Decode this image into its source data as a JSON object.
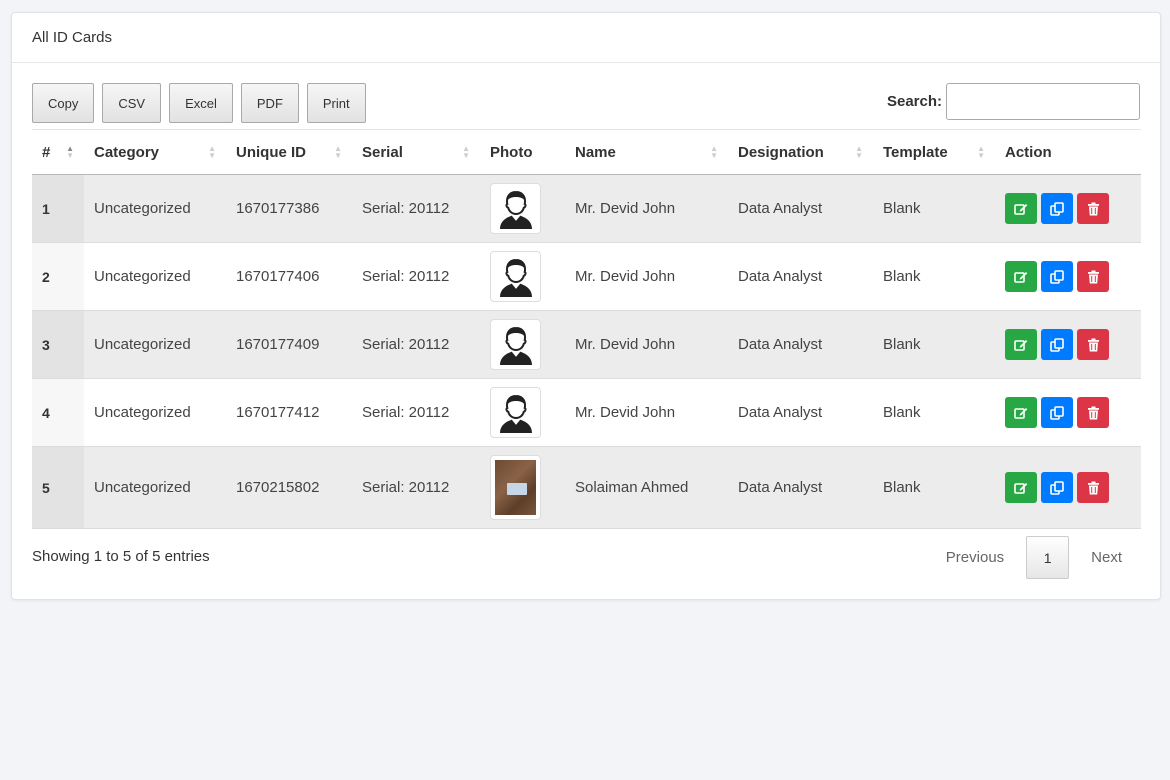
{
  "header": {
    "title": "All ID Cards"
  },
  "toolbar": {
    "buttons": [
      "Copy",
      "CSV",
      "Excel",
      "PDF",
      "Print"
    ]
  },
  "search": {
    "label": "Search:",
    "value": ""
  },
  "table": {
    "columns": [
      "#",
      "Category",
      "Unique ID",
      "Serial",
      "Photo",
      "Name",
      "Designation",
      "Template",
      "Action"
    ],
    "rows": [
      {
        "num": "1",
        "category": "Uncategorized",
        "uid": "1670177386",
        "serial": "Serial: 20112",
        "photo": "avatar-icon",
        "name": "Mr. Devid John",
        "designation": "Data Analyst",
        "template": "Blank"
      },
      {
        "num": "2",
        "category": "Uncategorized",
        "uid": "1670177406",
        "serial": "Serial: 20112",
        "photo": "avatar-icon",
        "name": "Mr. Devid John",
        "designation": "Data Analyst",
        "template": "Blank"
      },
      {
        "num": "3",
        "category": "Uncategorized",
        "uid": "1670177409",
        "serial": "Serial: 20112",
        "photo": "avatar-icon",
        "name": "Mr. Devid John",
        "designation": "Data Analyst",
        "template": "Blank"
      },
      {
        "num": "4",
        "category": "Uncategorized",
        "uid": "1670177412",
        "serial": "Serial: 20112",
        "photo": "avatar-icon",
        "name": "Mr. Devid John",
        "designation": "Data Analyst",
        "template": "Blank"
      },
      {
        "num": "5",
        "category": "Uncategorized",
        "uid": "1670215802",
        "serial": "Serial: 20112",
        "photo": "photo-thumbnail",
        "name": "Solaiman Ahmed",
        "designation": "Data Analyst",
        "template": "Blank"
      }
    ]
  },
  "actions": [
    "edit-icon",
    "copy-icon",
    "trash-icon"
  ],
  "colors": {
    "edit": "#28a745",
    "copy": "#007bff",
    "delete": "#dc3545"
  },
  "footer": {
    "info": "Showing 1 to 5 of 5 entries",
    "previous": "Previous",
    "page": "1",
    "next": "Next"
  }
}
